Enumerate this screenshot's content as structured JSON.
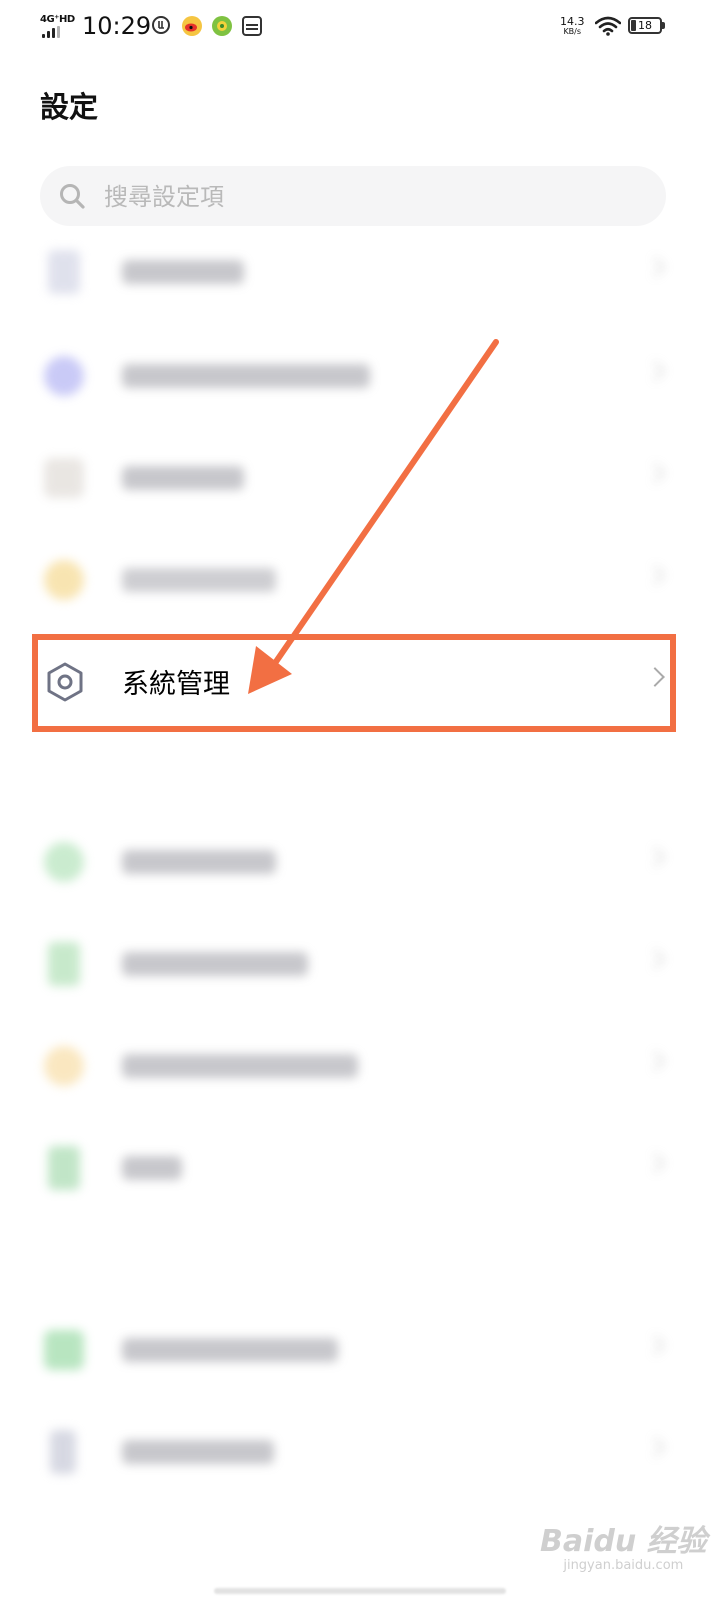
{
  "status_bar": {
    "network": "4G⁺HD",
    "time": "10:29",
    "net_speed_value": "14.3",
    "net_speed_unit": "KB/s",
    "battery": "18",
    "battery_level_fraction": 0.18
  },
  "header": {
    "title": "設定"
  },
  "search": {
    "placeholder": "搜尋設定項"
  },
  "settings": {
    "highlighted_item": {
      "label": "系統管理"
    },
    "blurred_item_colors": [
      "#c6c9de",
      "#9e9ff0",
      "#d8d2cc",
      "#f3cf72",
      "#9fdca8",
      "#9bd8a2",
      "#f6d48e",
      "#8fd19a",
      "#7fd18e",
      "#b6b9cc"
    ]
  },
  "annotation": {
    "color": "#f26f43"
  },
  "watermark": {
    "brand": "Baidu 经验",
    "site": "jingyan.baidu.com"
  }
}
